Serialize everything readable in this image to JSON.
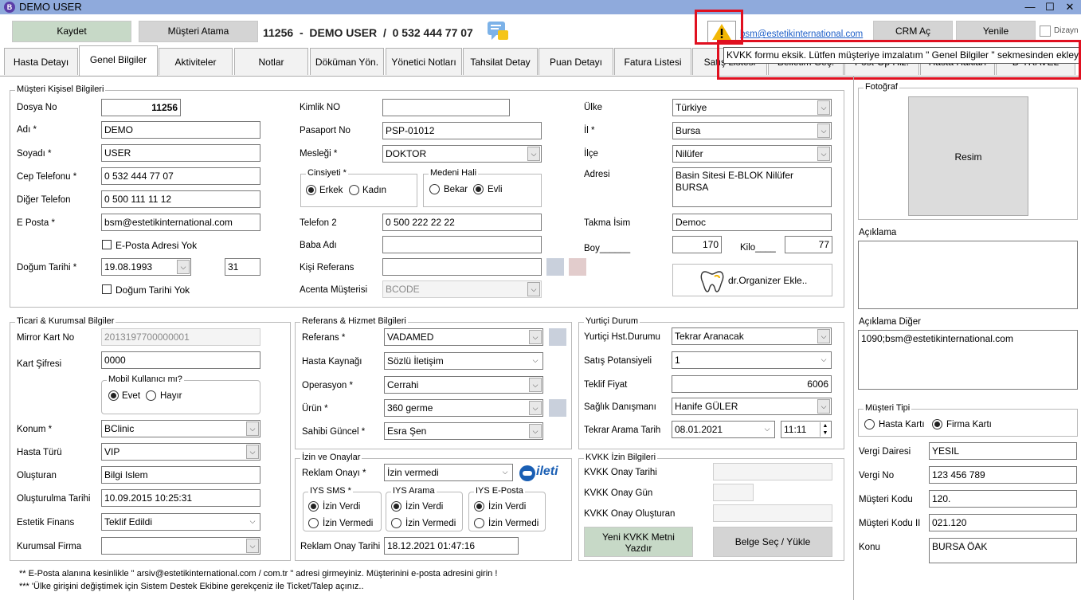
{
  "window": {
    "title": "DEMO USER",
    "app_icon": "B",
    "min": "—",
    "max": "☐",
    "close": "✕"
  },
  "toolbar": {
    "save": "Kaydet",
    "assign": "Müşteri Atama",
    "header": "11256  -  DEMO USER  /  0 532 444 77 07",
    "email_link": "bsm@estetikinternational.com",
    "crm": "CRM Aç",
    "refresh": "Yenile",
    "design": "Dizayn"
  },
  "tooltip": "KVKK formu eksik. Lütfen müşteriye imzalatım \" Genel Bilgiler \" sekmesinden ekleyin!",
  "tabs": [
    "Hasta Detayı",
    "Genel Bilgiler",
    "Aktiviteler",
    "Notlar",
    "Döküman Yön.",
    "Yönetici Notları",
    "Tahsilat Detay",
    "Puan Detayı",
    "Fatura Listesi",
    "Satış Listesi",
    "Belletim Geç.",
    "Post-Op Hiz.",
    "Hasta Hakları",
    "D-TRAVEL"
  ],
  "personal": {
    "title": "Müşteri Kişisel Bilgileri",
    "dosya_lbl": "Dosya No",
    "dosya": "11256",
    "adi_lbl": "Adı *",
    "adi": "DEMO",
    "soyadi_lbl": "Soyadı *",
    "soyadi": "USER",
    "cep_lbl": "Cep Telefonu *",
    "cep": "0 532 444 77 07",
    "diger_lbl": "Diğer Telefon",
    "diger": "0 500 111 11 12",
    "eposta_lbl": "E Posta *",
    "eposta": "bsm@estetikinternational.com",
    "eposta_yok": "E-Posta Adresi Yok",
    "dogum_lbl": "Doğum Tarihi *",
    "dogum": "19.08.1993",
    "yas": "31",
    "dogum_yok": "Doğum Tarihi Yok",
    "kimlik_lbl": "Kimlik NO",
    "kimlik": "",
    "pasaport_lbl": "Pasaport No",
    "pasaport": "PSP-01012",
    "meslek_lbl": "Mesleği *",
    "meslek": "DOKTOR",
    "cins_title": "Cinsiyeti  *",
    "erkek": "Erkek",
    "kadin": "Kadın",
    "medeni_title": "Medeni Hali",
    "bekar": "Bekar",
    "evli": "Evli",
    "tel2_lbl": "Telefon 2",
    "tel2": "0 500 222 22 22",
    "baba_lbl": "Baba Adı",
    "baba": "",
    "kisiref_lbl": "Kişi Referans",
    "kisiref": "",
    "acenta_lbl": "Acenta Müşterisi",
    "acenta": "BCODE",
    "ulke_lbl": "Ülke",
    "ulke": "Türkiye",
    "il_lbl": "İl *",
    "il": "Bursa",
    "ilce_lbl": "İlçe",
    "ilce": "Nilüfer",
    "adres_lbl": "Adresi",
    "adres1": "Basin Sitesi E-BLOK Nilüfer",
    "adres2": "BURSA",
    "takma_lbl": "Takma İsim",
    "takma": "Democ",
    "boy_lbl": "Boy______",
    "boy": "170",
    "kilo_lbl": "Kilo____",
    "kilo": "77",
    "dr_btn": "dr.Organizer Ekle.."
  },
  "photo": {
    "title": "Fotoğraf",
    "resim": "Resim",
    "aciklama": "Açıklama",
    "aciklama_diger": "Açıklama Diğer",
    "aciklama_diger_val": "1090;bsm@estetikinternational.com"
  },
  "ticari": {
    "title": "Ticari & Kurumsal Bilgiler",
    "mirror_lbl": "Mirror Kart No",
    "mirror": "2013197700000001",
    "sifre_lbl": "Kart Şifresi",
    "sifre": "0000",
    "mobil_title": "Mobil Kullanıcı mı?",
    "evet": "Evet",
    "hayir": "Hayır",
    "konum_lbl": "Konum *",
    "konum": "BClinic",
    "turu_lbl": "Hasta Türü",
    "turu": "VIP",
    "olusturan_lbl": "Oluşturan",
    "olusturan": "Bilgi Islem",
    "olus_tarih_lbl": "Oluşturulma Tarihi",
    "olus_tarih": "10.09.2015 10:25:31",
    "finans_lbl": "Estetik Finans",
    "finans": "Teklif Edildi",
    "firma_lbl": "Kurumsal Firma",
    "firma": ""
  },
  "referans": {
    "title": "Referans  & Hizmet Bilgileri",
    "ref_lbl": "Referans *",
    "ref": "VADAMED",
    "kaynak_lbl": "Hasta Kaynağı",
    "kaynak": "Sözlü İletişim",
    "op_lbl": "Operasyon *",
    "op": "Cerrahi",
    "urun_lbl": "Ürün *",
    "urun": "360 germe",
    "sahibi_lbl": "Sahibi Güncel *",
    "sahibi": "Esra Şen"
  },
  "yurtici": {
    "title": "Yurtiçi Durum",
    "durum_lbl": "Yurtiçi Hst.Durumu",
    "durum": "Tekrar Aranacak",
    "pot_lbl": "Satış Potansiyeli",
    "pot": "1",
    "fiyat_lbl": "Teklif Fiyat",
    "fiyat": "6006",
    "danisman_lbl": "Sağlık Danışmanı",
    "danisman": "Hanife GÜLER",
    "tarih_lbl": "Tekrar Arama Tarih",
    "tarih": "08.01.2021",
    "saat": "11:11"
  },
  "izin": {
    "title": "İzin ve Onaylar",
    "reklam_lbl": "Reklam Onayı *",
    "reklam": "İzin vermedi",
    "ileti": "ileti",
    "sms_title": "IYS SMS *",
    "arama_title": "IYS Arama",
    "eposta_title": "IYS E-Posta",
    "verdi": "İzin Verdi",
    "vermedi": "İzin Vermedi",
    "tarih_lbl": "Reklam Onay Tarihi",
    "tarih": "18.12.2021 01:47:16"
  },
  "kvkk": {
    "title": "KVKK İzin Bilgileri",
    "tarih_lbl": "KVKK Onay Tarihi",
    "gun_lbl": "KVKK Onay Gün",
    "olus_lbl": "KVKK Onay Oluşturan",
    "yeni_btn1": "Yeni KVKK Metni",
    "yeni_btn2": "Yazdır",
    "belge_btn": "Belge Seç / Yükle"
  },
  "musteri_tipi": {
    "title": "Müşteri Tipi",
    "hasta": "Hasta Kartı",
    "firma": "Firma Kartı",
    "vd_lbl": "Vergi Dairesi",
    "vd": "YESIL",
    "vno_lbl": "Vergi No",
    "vno": "123 456 789",
    "kod_lbl": "Müşteri Kodu",
    "kod": "120.",
    "kod2_lbl": "Müşteri Kodu II",
    "kod2": "021.120",
    "konu_lbl": "Konu",
    "konu": "BURSA ÖAK"
  },
  "notes": {
    "n1": "** E-Posta alanına kesinlikle \" arsiv@estetikinternational.com / com.tr \" adresi girmeyiniz. Müşterinini e-posta adresini girin !",
    "n2": "*** 'Ülke girişini değiştimek için Sistem Destek Ekibine gerekçeniz ile Ticket/Talep açınız.."
  }
}
